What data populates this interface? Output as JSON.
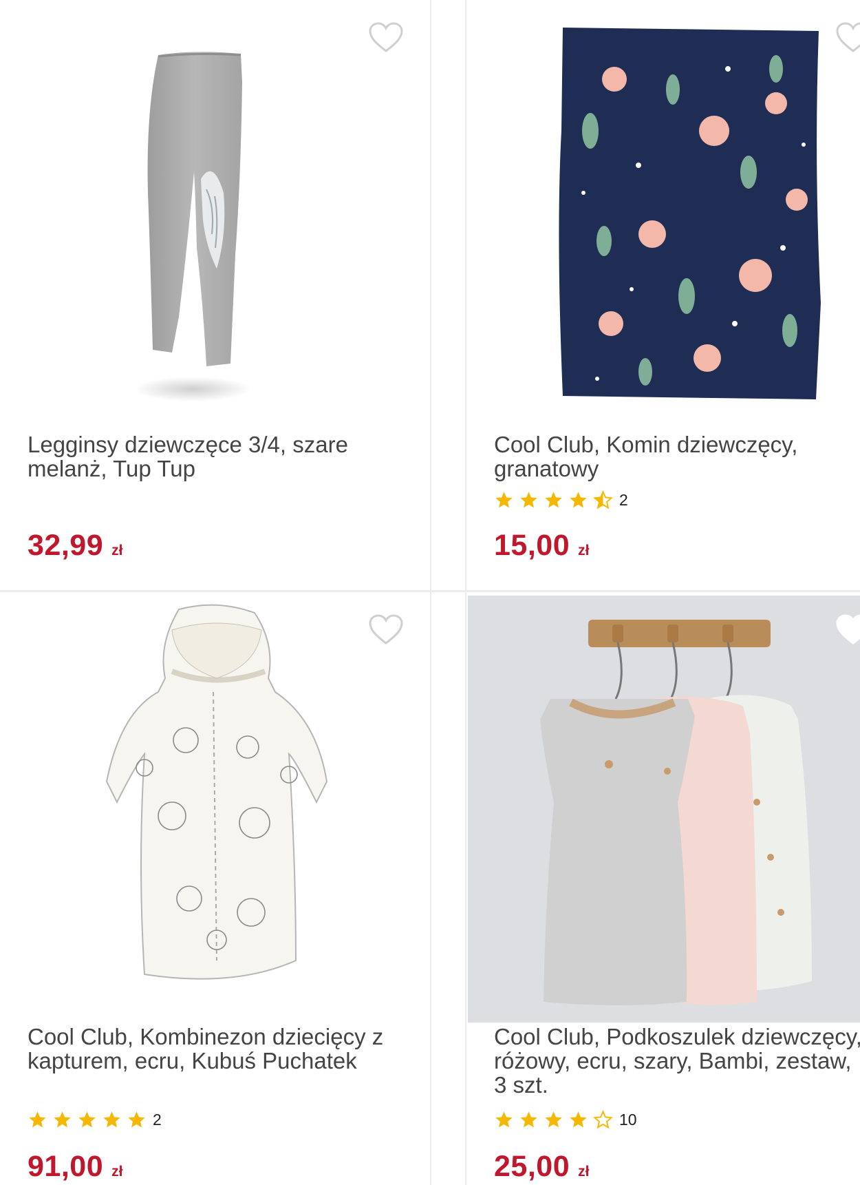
{
  "colors": {
    "price": "#c0172d",
    "star": "#f5b800",
    "heart_outline": "#cfcfcf"
  },
  "products": [
    {
      "title": "Legginsy dziewczęce 3/4, szare melanż, Tup Tup",
      "price": "32,99",
      "currency": "zł",
      "rating": null,
      "review_count": null,
      "image": "grey-leggings"
    },
    {
      "title": "Cool Club, Komin dziewczęcy, granatowy",
      "price": "15,00",
      "currency": "zł",
      "rating": 4.5,
      "review_count": "2",
      "image": "navy-floral-neck-warmer"
    },
    {
      "title": "Cool Club, Kombinezon dziecięcy z kapturem, ecru, Kubuś Puchatek",
      "price": "91,00",
      "currency": "zł",
      "rating": 5,
      "review_count": "2",
      "image": "ecru-hooded-sleepsuit"
    },
    {
      "title": "Cool Club, Podkoszulek dziewczęcy, różowy, ecru, szary, Bambi, zestaw, 3 szt.",
      "price": "25,00",
      "currency": "zł",
      "rating": 4,
      "review_count": "10",
      "image": "three-bambi-dresses-on-hangers"
    }
  ],
  "icons": {
    "favorite": "heart-outline-icon",
    "star_full": "star-icon",
    "star_half": "star-half-icon",
    "star_empty": "star-empty-icon"
  }
}
